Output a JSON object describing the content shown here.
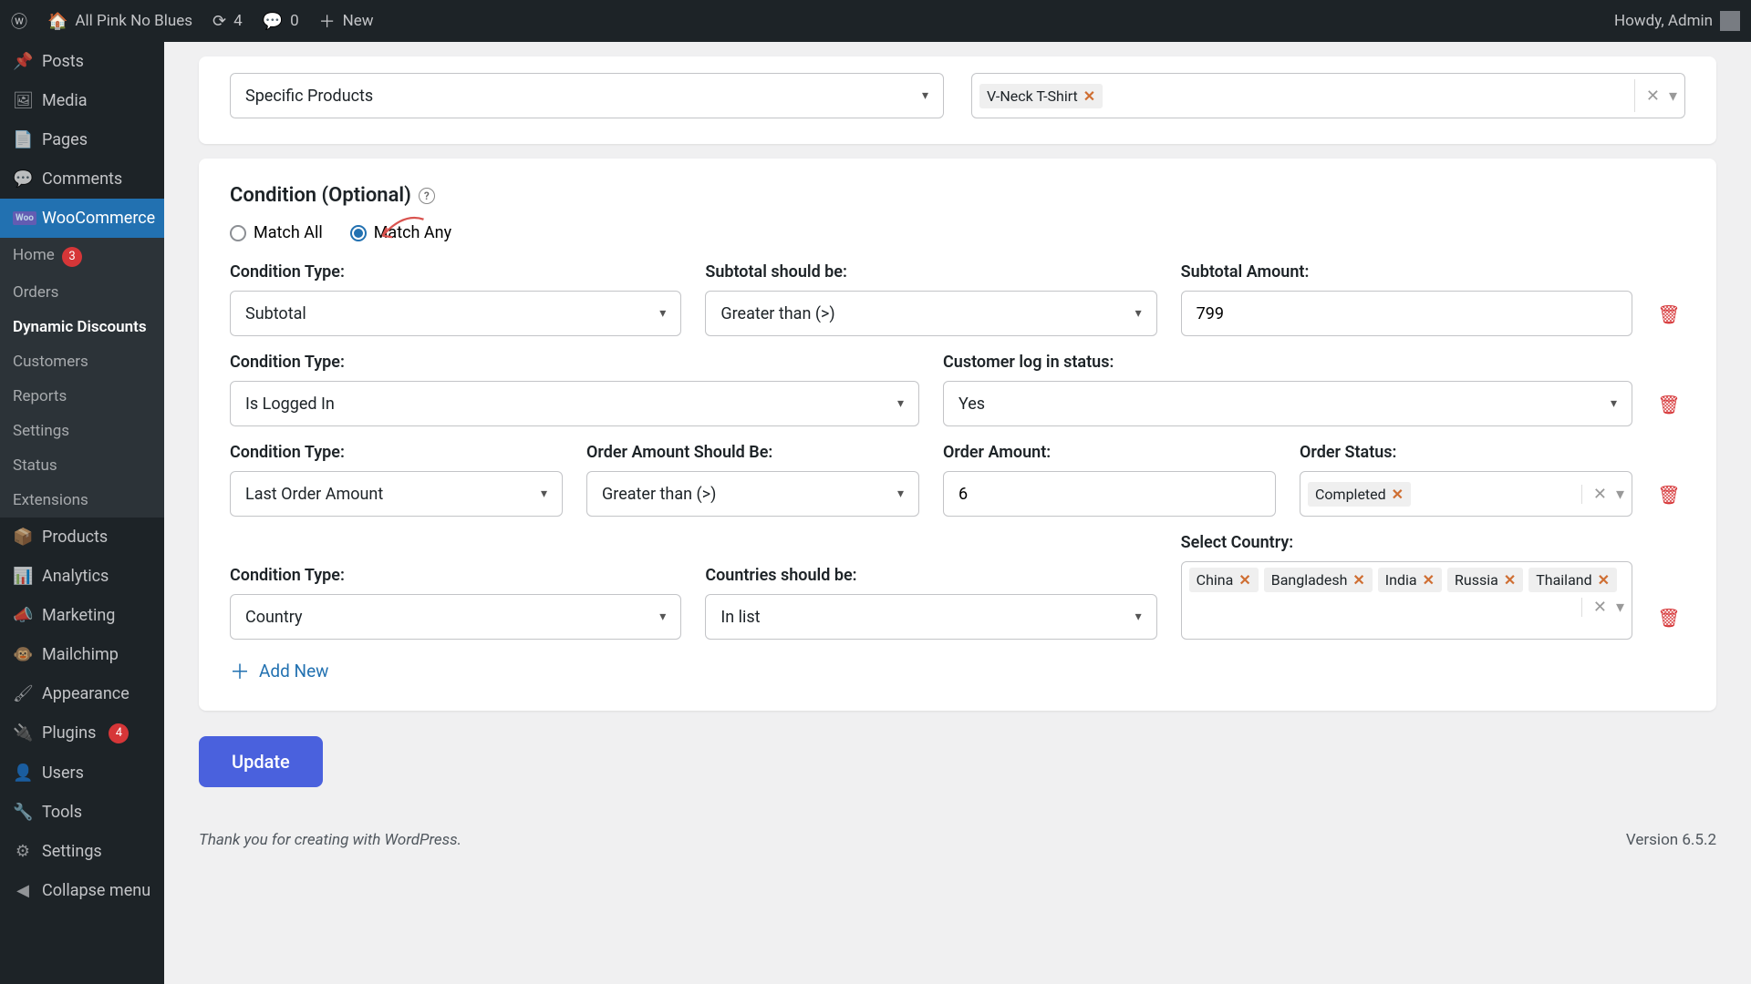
{
  "adminbar": {
    "site_name": "All Pink No Blues",
    "updates_count": "4",
    "comments_count": "0",
    "new_label": "New",
    "howdy": "Howdy, Admin"
  },
  "sidebar": {
    "items": [
      {
        "key": "posts",
        "label": "Posts",
        "icon": "📌"
      },
      {
        "key": "media",
        "label": "Media",
        "icon": "🖼"
      },
      {
        "key": "pages",
        "label": "Pages",
        "icon": "📄"
      },
      {
        "key": "comments",
        "label": "Comments",
        "icon": "💬"
      },
      {
        "key": "woocommerce",
        "label": "WooCommerce",
        "icon": "woo",
        "current": true
      },
      {
        "key": "products",
        "label": "Products",
        "icon": "📦"
      },
      {
        "key": "analytics",
        "label": "Analytics",
        "icon": "📊"
      },
      {
        "key": "marketing",
        "label": "Marketing",
        "icon": "📣"
      },
      {
        "key": "mailchimp",
        "label": "Mailchimp",
        "icon": "🐵"
      },
      {
        "key": "appearance",
        "label": "Appearance",
        "icon": "🖌"
      },
      {
        "key": "plugins",
        "label": "Plugins",
        "icon": "🔌",
        "badge": "4"
      },
      {
        "key": "users",
        "label": "Users",
        "icon": "👤"
      },
      {
        "key": "tools",
        "label": "Tools",
        "icon": "🔧"
      },
      {
        "key": "settings",
        "label": "Settings",
        "icon": "⚙"
      },
      {
        "key": "collapse",
        "label": "Collapse menu",
        "icon": "◀"
      }
    ],
    "woo_submenu": [
      {
        "key": "home",
        "label": "Home",
        "badge": "3"
      },
      {
        "key": "orders",
        "label": "Orders"
      },
      {
        "key": "dynamic-discounts",
        "label": "Dynamic Discounts",
        "active": true
      },
      {
        "key": "customers",
        "label": "Customers"
      },
      {
        "key": "reports",
        "label": "Reports"
      },
      {
        "key": "settings",
        "label": "Settings"
      },
      {
        "key": "status",
        "label": "Status"
      },
      {
        "key": "extensions",
        "label": "Extensions"
      }
    ]
  },
  "products_block": {
    "select_value": "Specific Products",
    "tags": [
      "V-Neck T-Shirt"
    ]
  },
  "condition": {
    "title": "Condition (Optional)",
    "match_all_label": "Match All",
    "match_any_label": "Match Any",
    "match_selected": "any",
    "rows": [
      {
        "type_label": "Condition Type:",
        "type_value": "Subtotal",
        "op_label": "Subtotal should be:",
        "op_value": "Greater than (>)",
        "amt_label": "Subtotal Amount:",
        "amt_value": "799"
      },
      {
        "type_label": "Condition Type:",
        "type_value": "Is Logged In",
        "status_label": "Customer log in status:",
        "status_value": "Yes"
      },
      {
        "type_label": "Condition Type:",
        "type_value": "Last Order Amount",
        "op_label": "Order Amount Should Be:",
        "op_value": "Greater than (>)",
        "amt_label": "Order Amount:",
        "amt_value": "6",
        "ostatus_label": "Order Status:",
        "ostatus_tags": [
          "Completed"
        ]
      },
      {
        "type_label": "Condition Type:",
        "type_value": "Country",
        "country_op_label": "Countries should be:",
        "country_op_value": "In list",
        "select_country_label": "Select Country:",
        "country_tags": [
          "China",
          "Bangladesh",
          "India",
          "Russia",
          "Thailand"
        ]
      }
    ],
    "add_new_label": "Add New"
  },
  "update_label": "Update",
  "footer": {
    "thanks": "Thank you for creating with WordPress.",
    "version": "Version 6.5.2"
  }
}
